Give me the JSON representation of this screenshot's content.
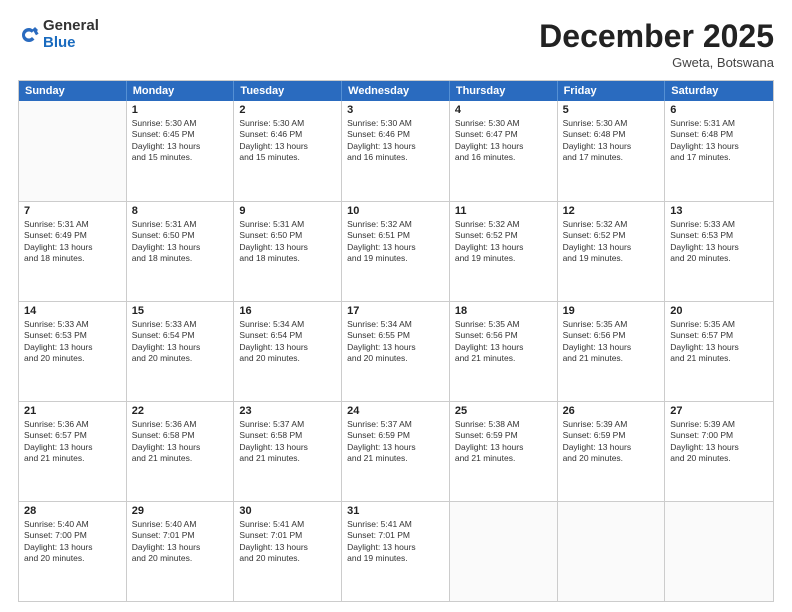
{
  "logo": {
    "general": "General",
    "blue": "Blue"
  },
  "title": "December 2025",
  "location": "Gweta, Botswana",
  "header_days": [
    "Sunday",
    "Monday",
    "Tuesday",
    "Wednesday",
    "Thursday",
    "Friday",
    "Saturday"
  ],
  "weeks": [
    [
      {
        "day": "",
        "content": ""
      },
      {
        "day": "1",
        "content": "Sunrise: 5:30 AM\nSunset: 6:45 PM\nDaylight: 13 hours\nand 15 minutes."
      },
      {
        "day": "2",
        "content": "Sunrise: 5:30 AM\nSunset: 6:46 PM\nDaylight: 13 hours\nand 15 minutes."
      },
      {
        "day": "3",
        "content": "Sunrise: 5:30 AM\nSunset: 6:46 PM\nDaylight: 13 hours\nand 16 minutes."
      },
      {
        "day": "4",
        "content": "Sunrise: 5:30 AM\nSunset: 6:47 PM\nDaylight: 13 hours\nand 16 minutes."
      },
      {
        "day": "5",
        "content": "Sunrise: 5:30 AM\nSunset: 6:48 PM\nDaylight: 13 hours\nand 17 minutes."
      },
      {
        "day": "6",
        "content": "Sunrise: 5:31 AM\nSunset: 6:48 PM\nDaylight: 13 hours\nand 17 minutes."
      }
    ],
    [
      {
        "day": "7",
        "content": "Sunrise: 5:31 AM\nSunset: 6:49 PM\nDaylight: 13 hours\nand 18 minutes."
      },
      {
        "day": "8",
        "content": "Sunrise: 5:31 AM\nSunset: 6:50 PM\nDaylight: 13 hours\nand 18 minutes."
      },
      {
        "day": "9",
        "content": "Sunrise: 5:31 AM\nSunset: 6:50 PM\nDaylight: 13 hours\nand 18 minutes."
      },
      {
        "day": "10",
        "content": "Sunrise: 5:32 AM\nSunset: 6:51 PM\nDaylight: 13 hours\nand 19 minutes."
      },
      {
        "day": "11",
        "content": "Sunrise: 5:32 AM\nSunset: 6:52 PM\nDaylight: 13 hours\nand 19 minutes."
      },
      {
        "day": "12",
        "content": "Sunrise: 5:32 AM\nSunset: 6:52 PM\nDaylight: 13 hours\nand 19 minutes."
      },
      {
        "day": "13",
        "content": "Sunrise: 5:33 AM\nSunset: 6:53 PM\nDaylight: 13 hours\nand 20 minutes."
      }
    ],
    [
      {
        "day": "14",
        "content": "Sunrise: 5:33 AM\nSunset: 6:53 PM\nDaylight: 13 hours\nand 20 minutes."
      },
      {
        "day": "15",
        "content": "Sunrise: 5:33 AM\nSunset: 6:54 PM\nDaylight: 13 hours\nand 20 minutes."
      },
      {
        "day": "16",
        "content": "Sunrise: 5:34 AM\nSunset: 6:54 PM\nDaylight: 13 hours\nand 20 minutes."
      },
      {
        "day": "17",
        "content": "Sunrise: 5:34 AM\nSunset: 6:55 PM\nDaylight: 13 hours\nand 20 minutes."
      },
      {
        "day": "18",
        "content": "Sunrise: 5:35 AM\nSunset: 6:56 PM\nDaylight: 13 hours\nand 21 minutes."
      },
      {
        "day": "19",
        "content": "Sunrise: 5:35 AM\nSunset: 6:56 PM\nDaylight: 13 hours\nand 21 minutes."
      },
      {
        "day": "20",
        "content": "Sunrise: 5:35 AM\nSunset: 6:57 PM\nDaylight: 13 hours\nand 21 minutes."
      }
    ],
    [
      {
        "day": "21",
        "content": "Sunrise: 5:36 AM\nSunset: 6:57 PM\nDaylight: 13 hours\nand 21 minutes."
      },
      {
        "day": "22",
        "content": "Sunrise: 5:36 AM\nSunset: 6:58 PM\nDaylight: 13 hours\nand 21 minutes."
      },
      {
        "day": "23",
        "content": "Sunrise: 5:37 AM\nSunset: 6:58 PM\nDaylight: 13 hours\nand 21 minutes."
      },
      {
        "day": "24",
        "content": "Sunrise: 5:37 AM\nSunset: 6:59 PM\nDaylight: 13 hours\nand 21 minutes."
      },
      {
        "day": "25",
        "content": "Sunrise: 5:38 AM\nSunset: 6:59 PM\nDaylight: 13 hours\nand 21 minutes."
      },
      {
        "day": "26",
        "content": "Sunrise: 5:39 AM\nSunset: 6:59 PM\nDaylight: 13 hours\nand 20 minutes."
      },
      {
        "day": "27",
        "content": "Sunrise: 5:39 AM\nSunset: 7:00 PM\nDaylight: 13 hours\nand 20 minutes."
      }
    ],
    [
      {
        "day": "28",
        "content": "Sunrise: 5:40 AM\nSunset: 7:00 PM\nDaylight: 13 hours\nand 20 minutes."
      },
      {
        "day": "29",
        "content": "Sunrise: 5:40 AM\nSunset: 7:01 PM\nDaylight: 13 hours\nand 20 minutes."
      },
      {
        "day": "30",
        "content": "Sunrise: 5:41 AM\nSunset: 7:01 PM\nDaylight: 13 hours\nand 20 minutes."
      },
      {
        "day": "31",
        "content": "Sunrise: 5:41 AM\nSunset: 7:01 PM\nDaylight: 13 hours\nand 19 minutes."
      },
      {
        "day": "",
        "content": ""
      },
      {
        "day": "",
        "content": ""
      },
      {
        "day": "",
        "content": ""
      }
    ]
  ]
}
